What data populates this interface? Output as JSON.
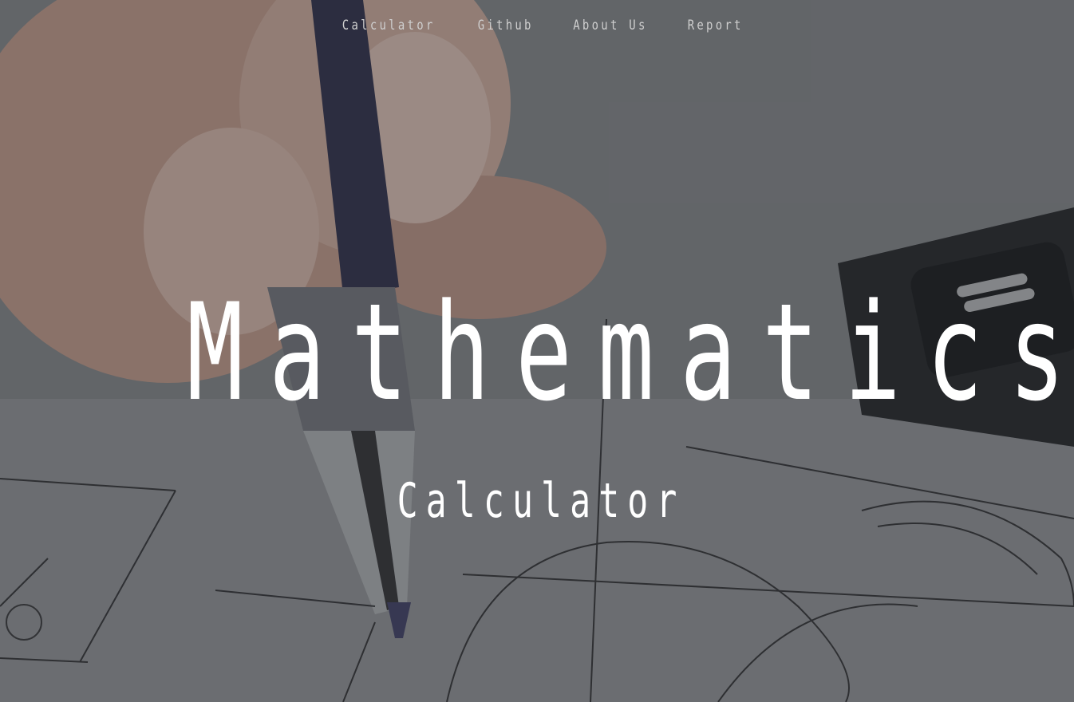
{
  "nav": {
    "items": [
      {
        "label": "Calculator"
      },
      {
        "label": "Github"
      },
      {
        "label": "About Us"
      },
      {
        "label": "Report"
      }
    ]
  },
  "hero": {
    "title": "Mathematics",
    "subtitle": "Calculator",
    "background": "hand-drawing-technical-sketch-with-pen-and-calculator"
  },
  "colors": {
    "text": "#ffffff",
    "nav_text": "#cfcfcf",
    "overlay": "#14161a"
  }
}
